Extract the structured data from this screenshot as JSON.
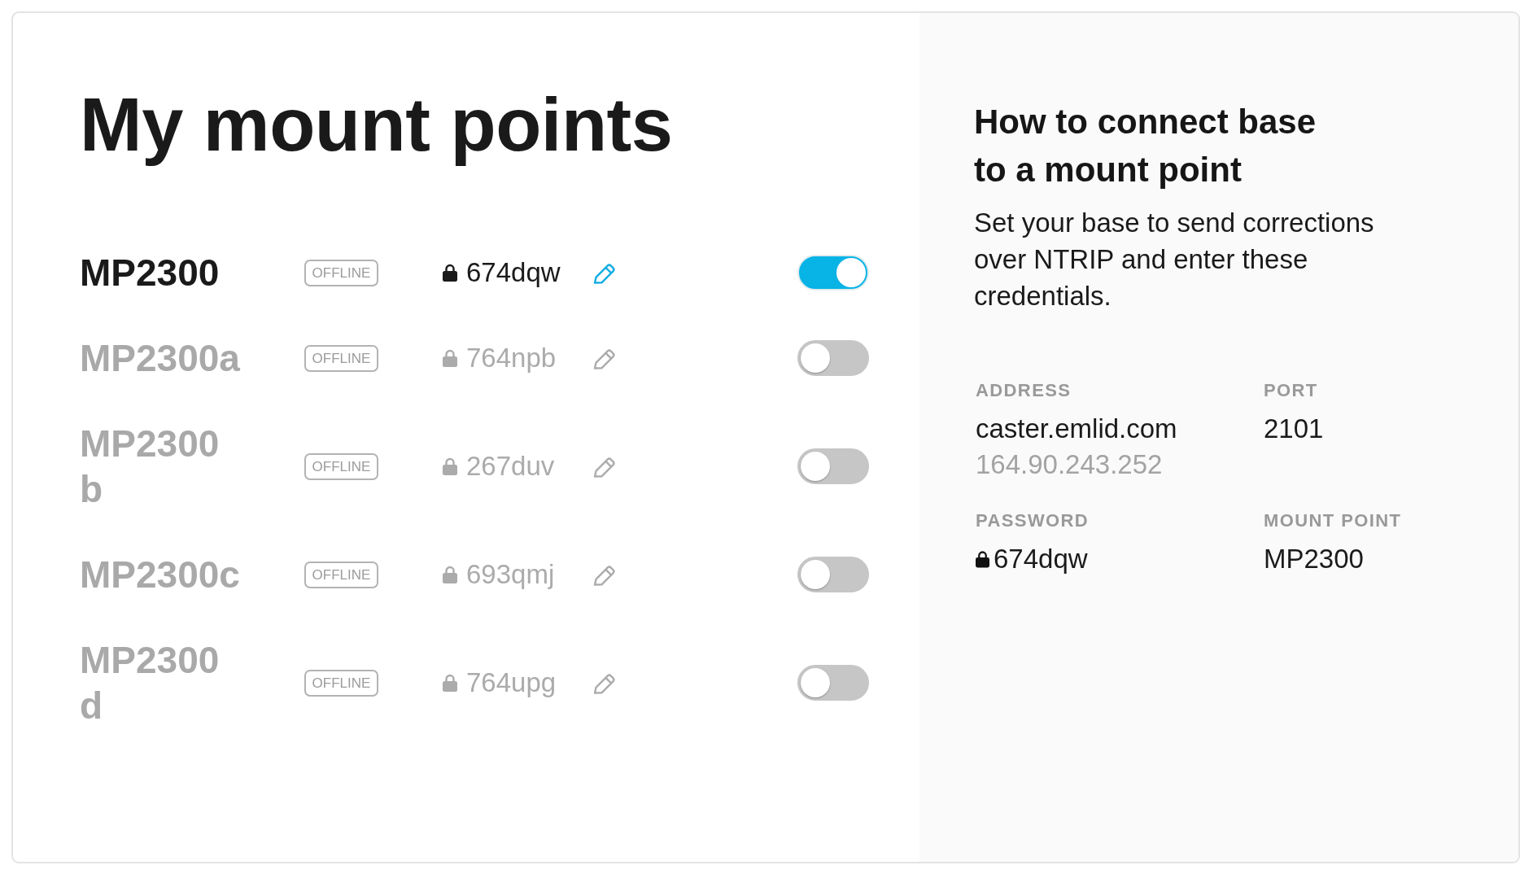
{
  "title": "My mount points",
  "mount_points": [
    {
      "name": "MP2300",
      "status": "OFFLINE",
      "password": "674dqw",
      "on": true
    },
    {
      "name": "MP2300a",
      "status": "OFFLINE",
      "password": "764npb",
      "on": false
    },
    {
      "name": "MP2300b",
      "status": "OFFLINE",
      "password": "267duv",
      "on": false
    },
    {
      "name": "MP2300c",
      "status": "OFFLINE",
      "password": "693qmj",
      "on": false
    },
    {
      "name": "MP2300d",
      "status": "OFFLINE",
      "password": "764upg",
      "on": false
    }
  ],
  "help": {
    "heading": "How to connect base to a mount point",
    "text": "Set your base to send corrections over NTRIP and enter these credentials.",
    "credentials": [
      {
        "kind": "text",
        "label": "ADDRESS",
        "value": "caster.emlid.com",
        "secondary": "164.90.243.252"
      },
      {
        "kind": "text",
        "label": "PORT",
        "value": "2101"
      },
      {
        "kind": "password",
        "label": "PASSWORD",
        "value": "674dqw"
      },
      {
        "kind": "text",
        "label": "MOUNT POINT",
        "value": "MP2300"
      }
    ]
  }
}
